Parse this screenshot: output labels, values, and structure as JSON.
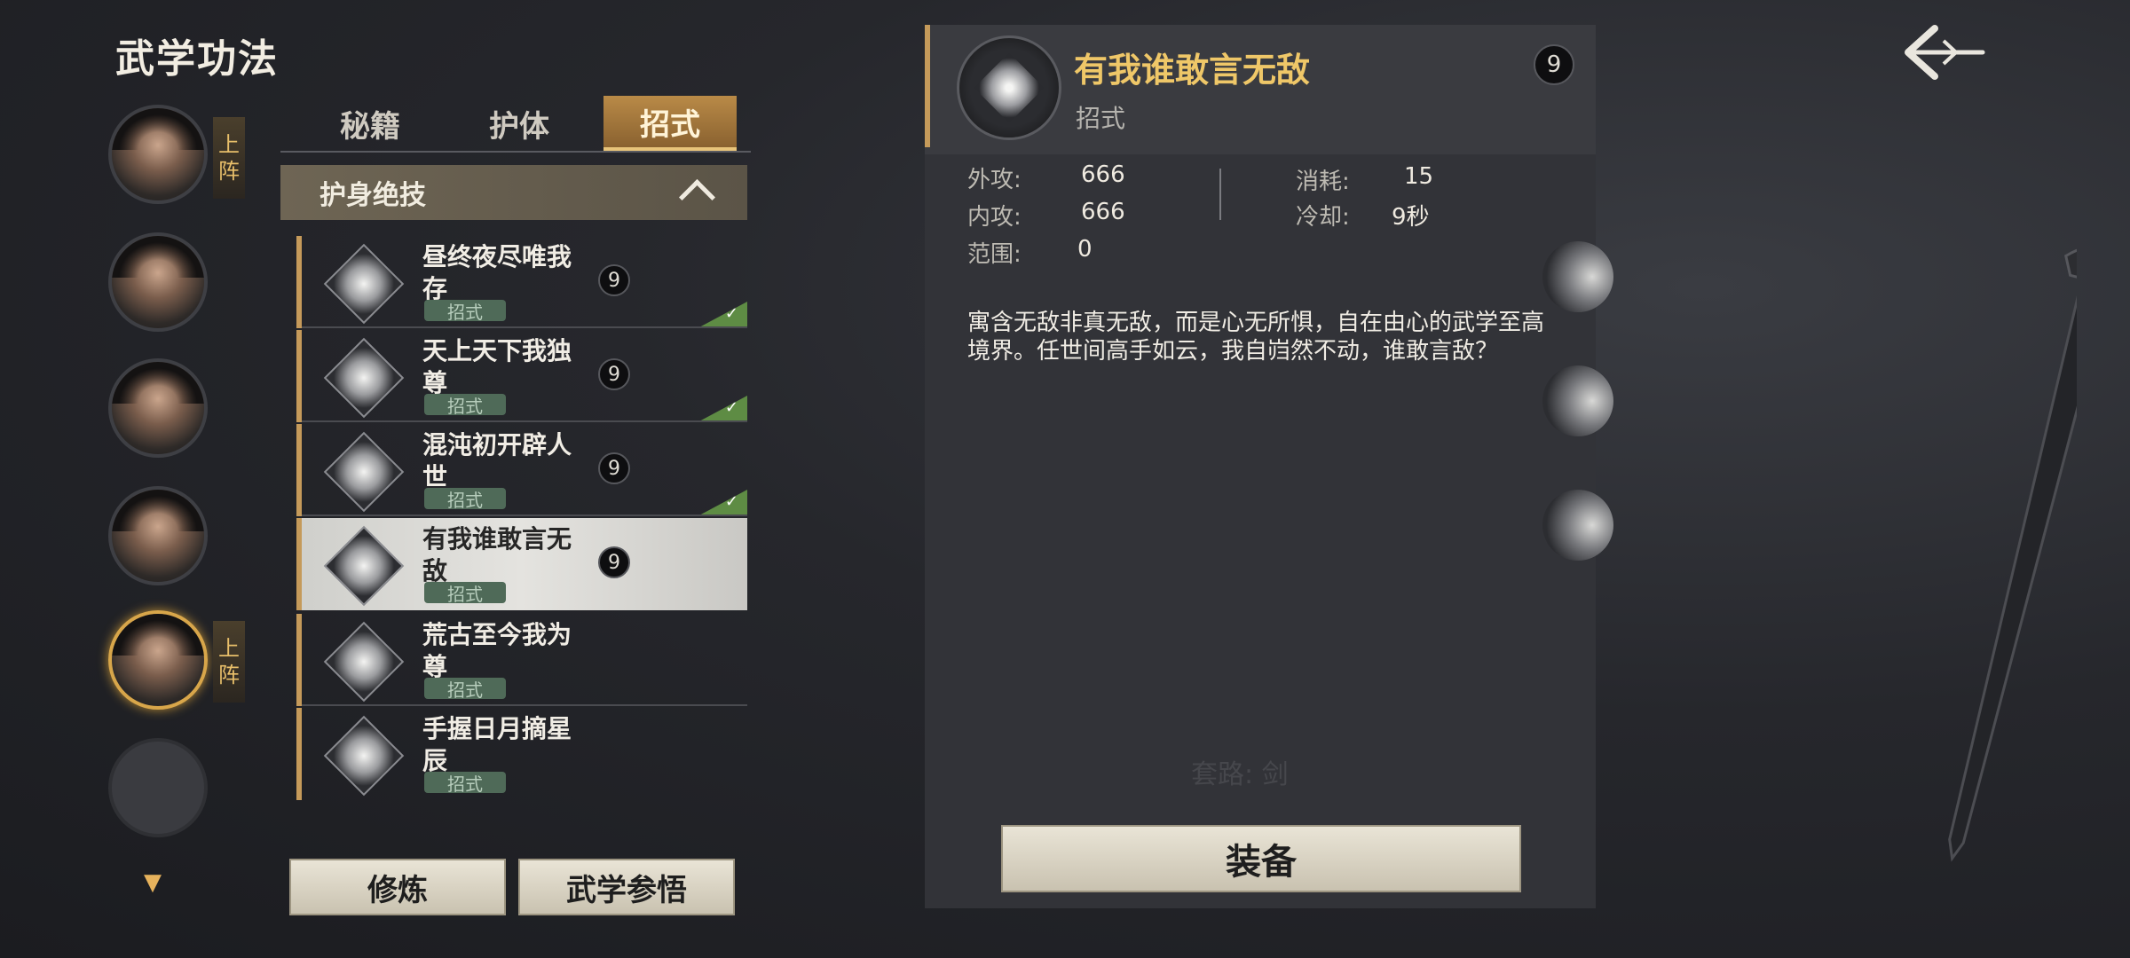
{
  "header": {
    "title": "武学功法"
  },
  "roster": {
    "deploy_label_top": "上",
    "deploy_label_bottom": "阵",
    "characters": [
      {
        "deployed": true
      },
      {
        "deployed": false
      },
      {
        "deployed": false
      },
      {
        "deployed": false
      },
      {
        "deployed": true,
        "selected": true
      },
      {
        "empty": true
      }
    ]
  },
  "tabs": [
    {
      "label": "秘籍",
      "active": false
    },
    {
      "label": "护体",
      "active": false
    },
    {
      "label": "招式",
      "active": true
    }
  ],
  "category": {
    "label": "护身绝技"
  },
  "skills": [
    {
      "name": "昼终夜尽唯我存",
      "type": "招式",
      "equipped": true,
      "selected": false,
      "sp_icon": "9"
    },
    {
      "name": "天上天下我独尊",
      "type": "招式",
      "equipped": true,
      "selected": false,
      "sp_icon": "9"
    },
    {
      "name": "混沌初开辟人世",
      "type": "招式",
      "equipped": true,
      "selected": false,
      "sp_icon": "9"
    },
    {
      "name": "有我谁敢言无敌",
      "type": "招式",
      "equipped": false,
      "selected": true,
      "sp_icon": "9"
    },
    {
      "name": "荒古至今我为尊",
      "type": "招式",
      "equipped": false,
      "selected": false
    },
    {
      "name": "手握日月摘星辰",
      "type": "招式",
      "equipped": false,
      "selected": false
    }
  ],
  "actions": {
    "train": "修炼",
    "insight": "武学参悟"
  },
  "detail": {
    "title": "有我谁敢言无敌",
    "type": "招式",
    "sp_icon": "9",
    "stats": {
      "outer_attack_label": "外攻:",
      "outer_attack": "666",
      "inner_attack_label": "内攻:",
      "inner_attack": "666",
      "range_label": "范围:",
      "range": "0",
      "cost_label": "消耗:",
      "cost": "15",
      "cooldown_label": "冷却:",
      "cooldown": "9秒"
    },
    "description": "寓含无敌非真无敌，而是心无所惧，自在由心的武学至高境界。任世间高手如云，我自岿然不动，谁敢言敌？",
    "weapon_hint": "套路: 剑",
    "equip_label": "装备"
  },
  "colors": {
    "accent_gold": "#efc768",
    "check_green": "#5e8c44",
    "bar_bronze": "#c59a5a"
  }
}
